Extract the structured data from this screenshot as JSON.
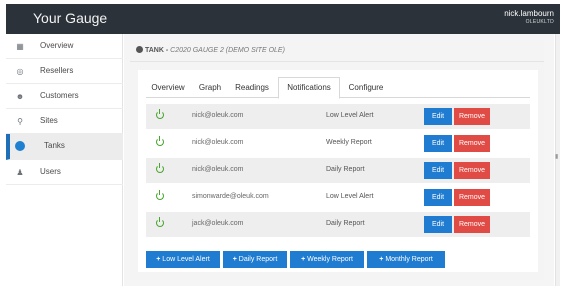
{
  "app": {
    "title": "Your Gauge"
  },
  "user": {
    "name": "nick.lambourn",
    "org": "OLEUKLTD"
  },
  "sidebar": {
    "items": [
      {
        "label": "Overview",
        "icon": "dashboard-icon"
      },
      {
        "label": "Resellers",
        "icon": "globe-icon"
      },
      {
        "label": "Customers",
        "icon": "users-icon"
      },
      {
        "label": "Sites",
        "icon": "map-marker-icon"
      },
      {
        "label": "Tanks",
        "icon": "tank-icon",
        "active": true
      },
      {
        "label": "Users",
        "icon": "user-icon"
      }
    ]
  },
  "tank": {
    "prefix": "TANK - ",
    "name": "C2020 GAUGE 2 (DEMO SITE OLE)"
  },
  "tabs": [
    {
      "label": "Overview"
    },
    {
      "label": "Graph"
    },
    {
      "label": "Readings"
    },
    {
      "label": "Notifications",
      "active": true
    },
    {
      "label": "Configure"
    }
  ],
  "notifications": [
    {
      "email": "nick@oleuk.com",
      "type": "Low Level Alert"
    },
    {
      "email": "nick@oleuk.com",
      "type": "Weekly Report"
    },
    {
      "email": "nick@oleuk.com",
      "type": "Daily Report"
    },
    {
      "email": "simonwarde@oleuk.com",
      "type": "Low Level Alert"
    },
    {
      "email": "jack@oleuk.com",
      "type": "Daily Report"
    }
  ],
  "row_buttons": {
    "edit": "Edit",
    "remove": "Remove"
  },
  "add_buttons": [
    {
      "label": "Low Level Alert"
    },
    {
      "label": "Daily Report"
    },
    {
      "label": "Weekly Report"
    },
    {
      "label": "Monthly Report"
    }
  ],
  "colors": {
    "topbar": "#2b323a",
    "primary": "#1f7cd0",
    "danger": "#e14b45",
    "status_on": "#48a52c"
  }
}
